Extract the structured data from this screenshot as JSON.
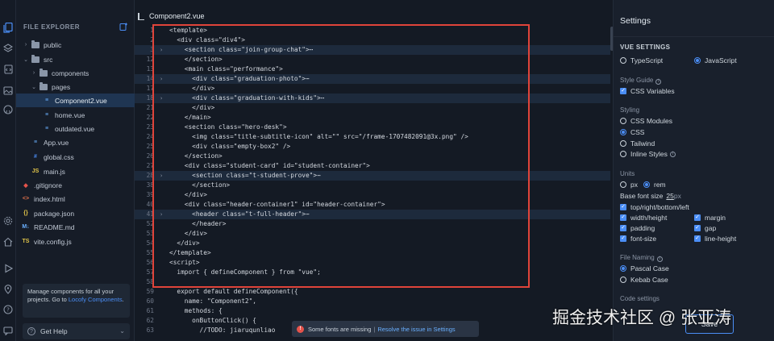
{
  "activity": {
    "icons": [
      "files-icon",
      "layers-icon",
      "file-code-icon",
      "image-icon",
      "github-icon",
      "settings-gear-icon",
      "home-icon",
      "play-icon",
      "location-pin-icon",
      "help-circle-icon",
      "chat-icon"
    ]
  },
  "explorer": {
    "title": "FILE EXPLORER",
    "items": [
      {
        "label": "public",
        "kind": "folder",
        "chevron": "›"
      },
      {
        "label": "src",
        "kind": "folder",
        "chevron": "⌄"
      },
      {
        "label": "components",
        "kind": "folder",
        "chevron": "›"
      },
      {
        "label": "pages",
        "kind": "folder",
        "chevron": "⌄"
      },
      {
        "label": "Component2.vue",
        "kind": "file",
        "tag": "≡"
      },
      {
        "label": "home.vue",
        "kind": "file",
        "tag": "≡"
      },
      {
        "label": "outdated.vue",
        "kind": "file",
        "tag": "≡"
      },
      {
        "label": "App.vue",
        "kind": "file",
        "tag": "≡"
      },
      {
        "label": "global.css",
        "kind": "file",
        "tag": "#"
      },
      {
        "label": "main.js",
        "kind": "file",
        "tag": "JS"
      },
      {
        "label": ".gitignore",
        "kind": "file",
        "tag": "◆"
      },
      {
        "label": "index.html",
        "kind": "file",
        "tag": "<>"
      },
      {
        "label": "package.json",
        "kind": "file",
        "tag": "{}"
      },
      {
        "label": "README.md",
        "kind": "file",
        "tag": "M↓"
      },
      {
        "label": "vite.config.js",
        "kind": "file",
        "tag": "TS"
      }
    ],
    "promo_text": "Manage components for all your projects. Go to ",
    "promo_link": "Locofy Components",
    "promo_end": ".",
    "help_label": "Get Help",
    "help_chevron": "⌄"
  },
  "editor": {
    "tab_label": "Component2.vue",
    "lines": [
      {
        "num": "1",
        "fold": "",
        "text": "<template>"
      },
      {
        "num": "2",
        "fold": "",
        "text": "  <div class=\"div4\">"
      },
      {
        "num": "3",
        "fold": "›",
        "text": "    <section class=\"join-group-chat\">⋯"
      },
      {
        "num": "12",
        "fold": "",
        "text": "    </section>"
      },
      {
        "num": "13",
        "fold": "",
        "text": "    <main class=\"performance\">"
      },
      {
        "num": "14",
        "fold": "›",
        "text": "      <div class=\"graduation-photo\">⋯"
      },
      {
        "num": "17",
        "fold": "",
        "text": "      </div>"
      },
      {
        "num": "18",
        "fold": "›",
        "text": "      <div class=\"graduation-with-kids\">⋯"
      },
      {
        "num": "21",
        "fold": "",
        "text": "      </div>"
      },
      {
        "num": "22",
        "fold": "",
        "text": "    </main>"
      },
      {
        "num": "23",
        "fold": "",
        "text": "    <section class=\"hero-desk\">"
      },
      {
        "num": "24",
        "fold": "",
        "text": "      <img class=\"title-subtitle-icon\" alt=\"\" src=\"/frame-1707482091@3x.png\" />"
      },
      {
        "num": "25",
        "fold": "",
        "text": "      <div class=\"empty-box2\" />"
      },
      {
        "num": "26",
        "fold": "",
        "text": "    </section>"
      },
      {
        "num": "27",
        "fold": "",
        "text": "    <div class=\"student-card\" id=\"student-container\">"
      },
      {
        "num": "28",
        "fold": "›",
        "text": "      <section class=\"t-student-prove\">⋯"
      },
      {
        "num": "38",
        "fold": "",
        "text": "      </section>"
      },
      {
        "num": "39",
        "fold": "",
        "text": "    </div>"
      },
      {
        "num": "40",
        "fold": "",
        "text": "    <div class=\"header-container1\" id=\"header-container\">"
      },
      {
        "num": "41",
        "fold": "›",
        "text": "      <header class=\"t-full-header\">⋯"
      },
      {
        "num": "52",
        "fold": "",
        "text": "      </header>"
      },
      {
        "num": "53",
        "fold": "",
        "text": "    </div>"
      },
      {
        "num": "54",
        "fold": "",
        "text": "  </div>"
      },
      {
        "num": "55",
        "fold": "",
        "text": "</template>"
      },
      {
        "num": "56",
        "fold": "",
        "text": "<script>"
      },
      {
        "num": "57",
        "fold": "",
        "text": "  import { defineComponent } from \"vue\";"
      },
      {
        "num": "58",
        "fold": "",
        "text": ""
      },
      {
        "num": "59",
        "fold": "",
        "text": "  export default defineComponent({"
      },
      {
        "num": "60",
        "fold": "",
        "text": "    name: \"Component2\","
      },
      {
        "num": "61",
        "fold": "",
        "text": "    methods: {"
      },
      {
        "num": "62",
        "fold": "",
        "text": "      onButtonClick() {"
      },
      {
        "num": "63",
        "fold": "",
        "text": "        //TODO: jiaruqunliao"
      }
    ],
    "toast_text": "Some fonts are missing",
    "toast_sep": "|",
    "toast_link": "Resolve the issue in Settings",
    "toast_icon": "!"
  },
  "settings": {
    "title": "Settings",
    "vue_settings": "VUE SETTINGS",
    "language_options": [
      {
        "label": "TypeScript",
        "selected": false
      },
      {
        "label": "JavaScript",
        "selected": true
      }
    ],
    "style_guide": "Style Guide",
    "css_variables": "CSS Variables",
    "styling": "Styling",
    "styling_options": [
      {
        "label": "CSS Modules",
        "selected": false
      },
      {
        "label": "CSS",
        "selected": true
      },
      {
        "label": "Tailwind",
        "selected": false
      },
      {
        "label": "Inline Styles",
        "selected": false
      }
    ],
    "units": "Units",
    "unit_options": [
      {
        "label": "px",
        "selected": false
      },
      {
        "label": "rem",
        "selected": true
      }
    ],
    "base_font_label": "Base font size",
    "base_font_value": "25",
    "base_font_unit": "px",
    "unit_checks": [
      "top/right/bottom/left",
      "width/height",
      "margin",
      "padding",
      "gap",
      "font-size",
      "line-height"
    ],
    "file_naming": "File Naming",
    "naming_options": [
      {
        "label": "Pascal Case",
        "selected": true
      },
      {
        "label": "Kebab Case",
        "selected": false
      }
    ],
    "code_settings": "Code settings",
    "save_label": "Save"
  },
  "watermark": "掘金技术社区 @ 张亚涛"
}
